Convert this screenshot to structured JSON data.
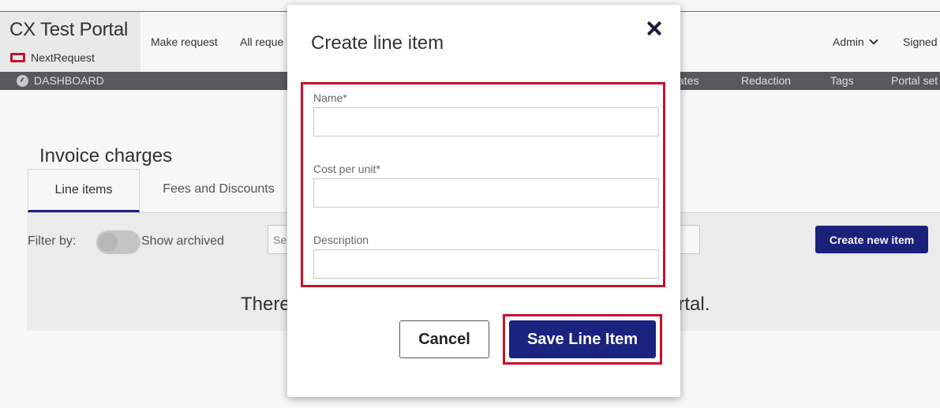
{
  "app": {
    "portal_title": "CX Test Portal",
    "logo_text": "NextRequest"
  },
  "nav": {
    "make_request": "Make request",
    "all_requests": "All reque",
    "admin": "Admin",
    "signed": "Signed"
  },
  "subnav": {
    "dashboard": "DASHBOARD",
    "templates": "ates",
    "redaction": "Redaction",
    "tags": "Tags",
    "portal_settings": "Portal set"
  },
  "page": {
    "title": "Invoice charges",
    "tabs": [
      {
        "label": "Line items",
        "active": true
      },
      {
        "label": "Fees and Discounts",
        "active": false
      }
    ],
    "filter_label": "Filter by:",
    "show_archived": "Show archived",
    "search_placeholder": "Se",
    "create_button": "Create new item",
    "empty_message_start": "There",
    "empty_message_end": "ortal."
  },
  "modal": {
    "title": "Create line item",
    "fields": {
      "name_label": "Name*",
      "name_value": "",
      "cost_label": "Cost per unit*",
      "cost_value": "",
      "description_label": "Description",
      "description_value": ""
    },
    "cancel_label": "Cancel",
    "save_label": "Save Line Item"
  },
  "colors": {
    "primary": "#1a237e",
    "highlight": "#c8102e",
    "subnav_bg": "#5b5b63"
  }
}
